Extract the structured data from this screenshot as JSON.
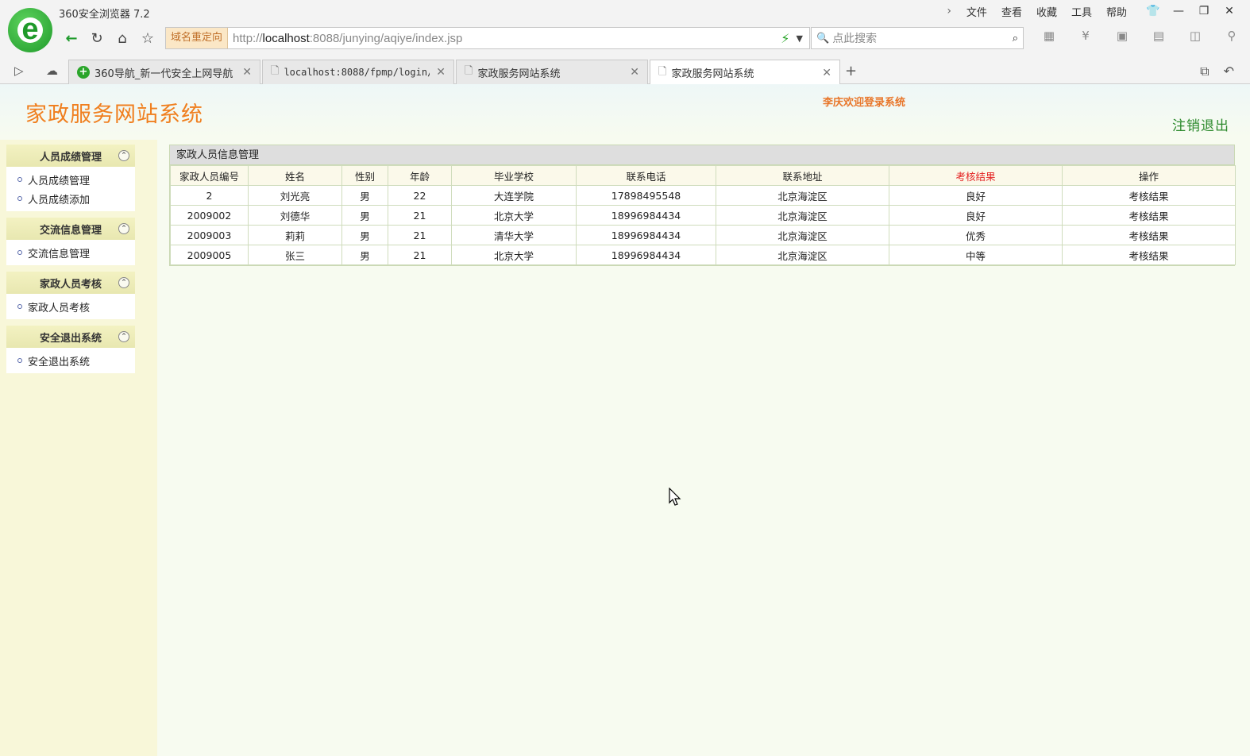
{
  "browser": {
    "title": "360安全浏览器 7.2",
    "menu": [
      "文件",
      "查看",
      "收藏",
      "工具",
      "帮助"
    ],
    "redirect_label": "域名重定向",
    "url_prefix": "http://",
    "url_host": "localhost",
    "url_rest": ":8088/junying/aqiye/index.jsp",
    "search_placeholder": "点此搜索",
    "tabs": [
      {
        "label": "360导航_新一代安全上网导航"
      },
      {
        "label": "localhost:8088/fpmp/login/"
      },
      {
        "label": "家政服务网站系统"
      },
      {
        "label": "家政服务网站系统"
      }
    ]
  },
  "header": {
    "site_title": "家政服务网站系统",
    "welcome": "李庆欢迎登录系统",
    "logout": "注销退出"
  },
  "sidebar": {
    "sections": [
      {
        "title": "人员成绩管理",
        "items": [
          "人员成绩管理",
          "人员成绩添加"
        ]
      },
      {
        "title": "交流信息管理",
        "items": [
          "交流信息管理"
        ]
      },
      {
        "title": "家政人员考核",
        "items": [
          "家政人员考核"
        ]
      },
      {
        "title": "安全退出系统",
        "items": [
          "安全退出系统"
        ]
      }
    ]
  },
  "main": {
    "panel_title": "家政人员信息管理",
    "columns": [
      "家政人员编号",
      "姓名",
      "性别",
      "年龄",
      "毕业学校",
      "联系电话",
      "联系地址",
      "考核结果",
      "操作"
    ],
    "highlight_color": "#e42424",
    "rows": [
      [
        "2",
        "刘光亮",
        "男",
        "22",
        "大连学院",
        "17898495548",
        "北京海淀区",
        "良好",
        "考核结果"
      ],
      [
        "2009002",
        "刘德华",
        "男",
        "21",
        "北京大学",
        "18996984434",
        "北京海淀区",
        "良好",
        "考核结果"
      ],
      [
        "2009003",
        "莉莉",
        "男",
        "21",
        "清华大学",
        "18996984434",
        "北京海淀区",
        "优秀",
        "考核结果"
      ],
      [
        "2009005",
        "张三",
        "男",
        "21",
        "北京大学",
        "18996984434",
        "北京海淀区",
        "中等",
        "考核结果"
      ]
    ]
  }
}
